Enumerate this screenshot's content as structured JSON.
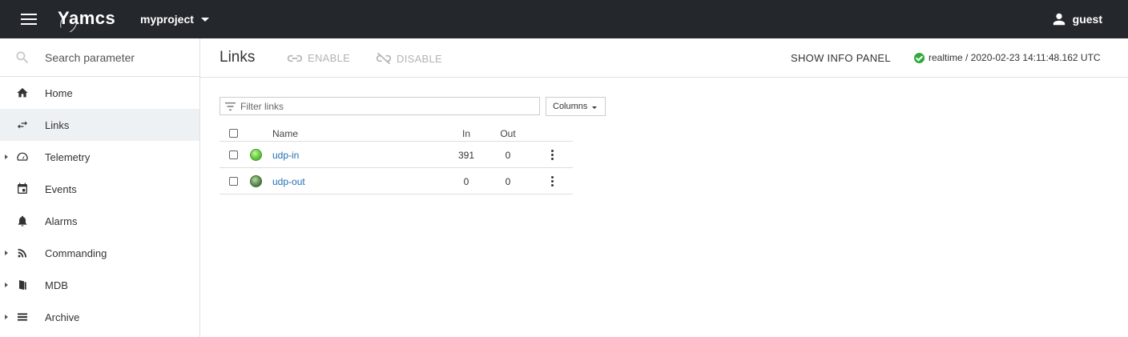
{
  "topbar": {
    "app_name": "Yamcs",
    "project": "myproject",
    "user": "guest"
  },
  "sidebar": {
    "search_placeholder": "Search parameter",
    "items": [
      {
        "label": "Home",
        "icon": "home-icon",
        "active": false,
        "expandable": false
      },
      {
        "label": "Links",
        "icon": "swap-arrows-icon",
        "active": true,
        "expandable": false
      },
      {
        "label": "Telemetry",
        "icon": "speedometer-icon",
        "active": false,
        "expandable": true
      },
      {
        "label": "Events",
        "icon": "calendar-icon",
        "active": false,
        "expandable": false
      },
      {
        "label": "Alarms",
        "icon": "bell-icon",
        "active": false,
        "expandable": false
      },
      {
        "label": "Commanding",
        "icon": "rss-icon",
        "active": false,
        "expandable": true
      },
      {
        "label": "MDB",
        "icon": "book-icon",
        "active": false,
        "expandable": true
      },
      {
        "label": "Archive",
        "icon": "list-icon",
        "active": false,
        "expandable": true
      }
    ]
  },
  "header": {
    "title": "Links",
    "enable_label": "ENABLE",
    "disable_label": "DISABLE",
    "info_panel_label": "SHOW INFO PANEL",
    "status_text": "realtime / 2020-02-23 14:11:48.162 UTC"
  },
  "filter": {
    "placeholder": "Filter links",
    "columns_label": "Columns"
  },
  "table": {
    "headers": {
      "name": "Name",
      "in": "In",
      "out": "Out"
    },
    "rows": [
      {
        "name": "udp-in",
        "in": "391",
        "out": "0",
        "status": "active"
      },
      {
        "name": "udp-out",
        "in": "0",
        "out": "0",
        "status": "idle"
      }
    ]
  },
  "colors": {
    "topbar_bg": "#24282d",
    "link_color": "#1f6fb5",
    "ok_green": "#2eaa3c"
  }
}
